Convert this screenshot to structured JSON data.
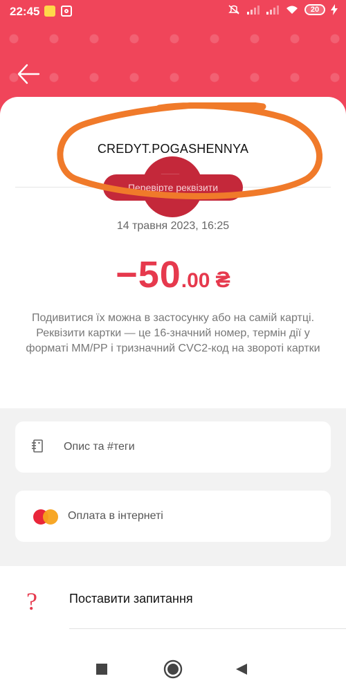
{
  "status_bar": {
    "time": "22:45",
    "battery": "20",
    "icons": [
      "notification-icon",
      "instagram-icon",
      "mute-icon",
      "signal-icon",
      "signal-icon",
      "wifi-icon",
      "battery-icon",
      "charging-icon"
    ]
  },
  "header": {
    "back_icon": "arrow-left-icon",
    "accent_color": "#f0455a"
  },
  "transaction": {
    "merchant_icon": "no-image-icon",
    "title": "CREDYT.POGASHENNYA",
    "check_details_button": "Перевірте реквізити",
    "datetime": "14 травня 2023, 16:25",
    "amount_main": "−50",
    "amount_cents": ".00",
    "currency": "₴",
    "description": "Подивитися їх можна в застосунку або на самій картці.\nРеквізити картки — це 16-значний номер, термін дії у форматі ММ/РР і тризначний CVC2-код на звороті картки"
  },
  "options": [
    {
      "icon": "notebook-icon",
      "label": "Опис та #теги"
    },
    {
      "icon": "mastercard-icon",
      "label": "Оплата в інтернеті"
    }
  ],
  "bottom": {
    "question_icon": "question-mark-icon",
    "ask_label": "Поставити запитання"
  },
  "nav": {
    "icons": [
      "square-icon",
      "home-circle-icon",
      "back-triangle-icon"
    ]
  }
}
